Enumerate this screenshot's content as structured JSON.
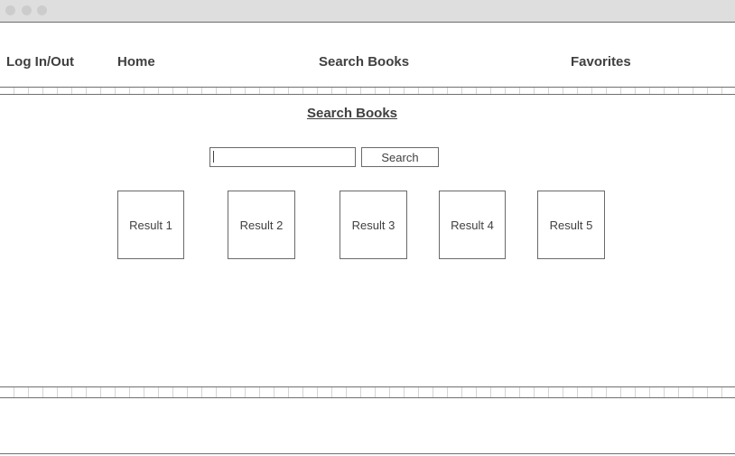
{
  "nav": {
    "login": "Log In/Out",
    "home": "Home",
    "search": "Search Books",
    "favorites": "Favorites"
  },
  "page": {
    "title": "Search Books"
  },
  "search": {
    "value": "",
    "button_label": "Search"
  },
  "results": [
    {
      "label": "Result 1"
    },
    {
      "label": "Result 2"
    },
    {
      "label": "Result 3"
    },
    {
      "label": "Result 4"
    },
    {
      "label": "Result 5"
    }
  ],
  "colors": {
    "titlebar": "#dedede",
    "text": "#404040",
    "border": "#6a6a6a"
  }
}
